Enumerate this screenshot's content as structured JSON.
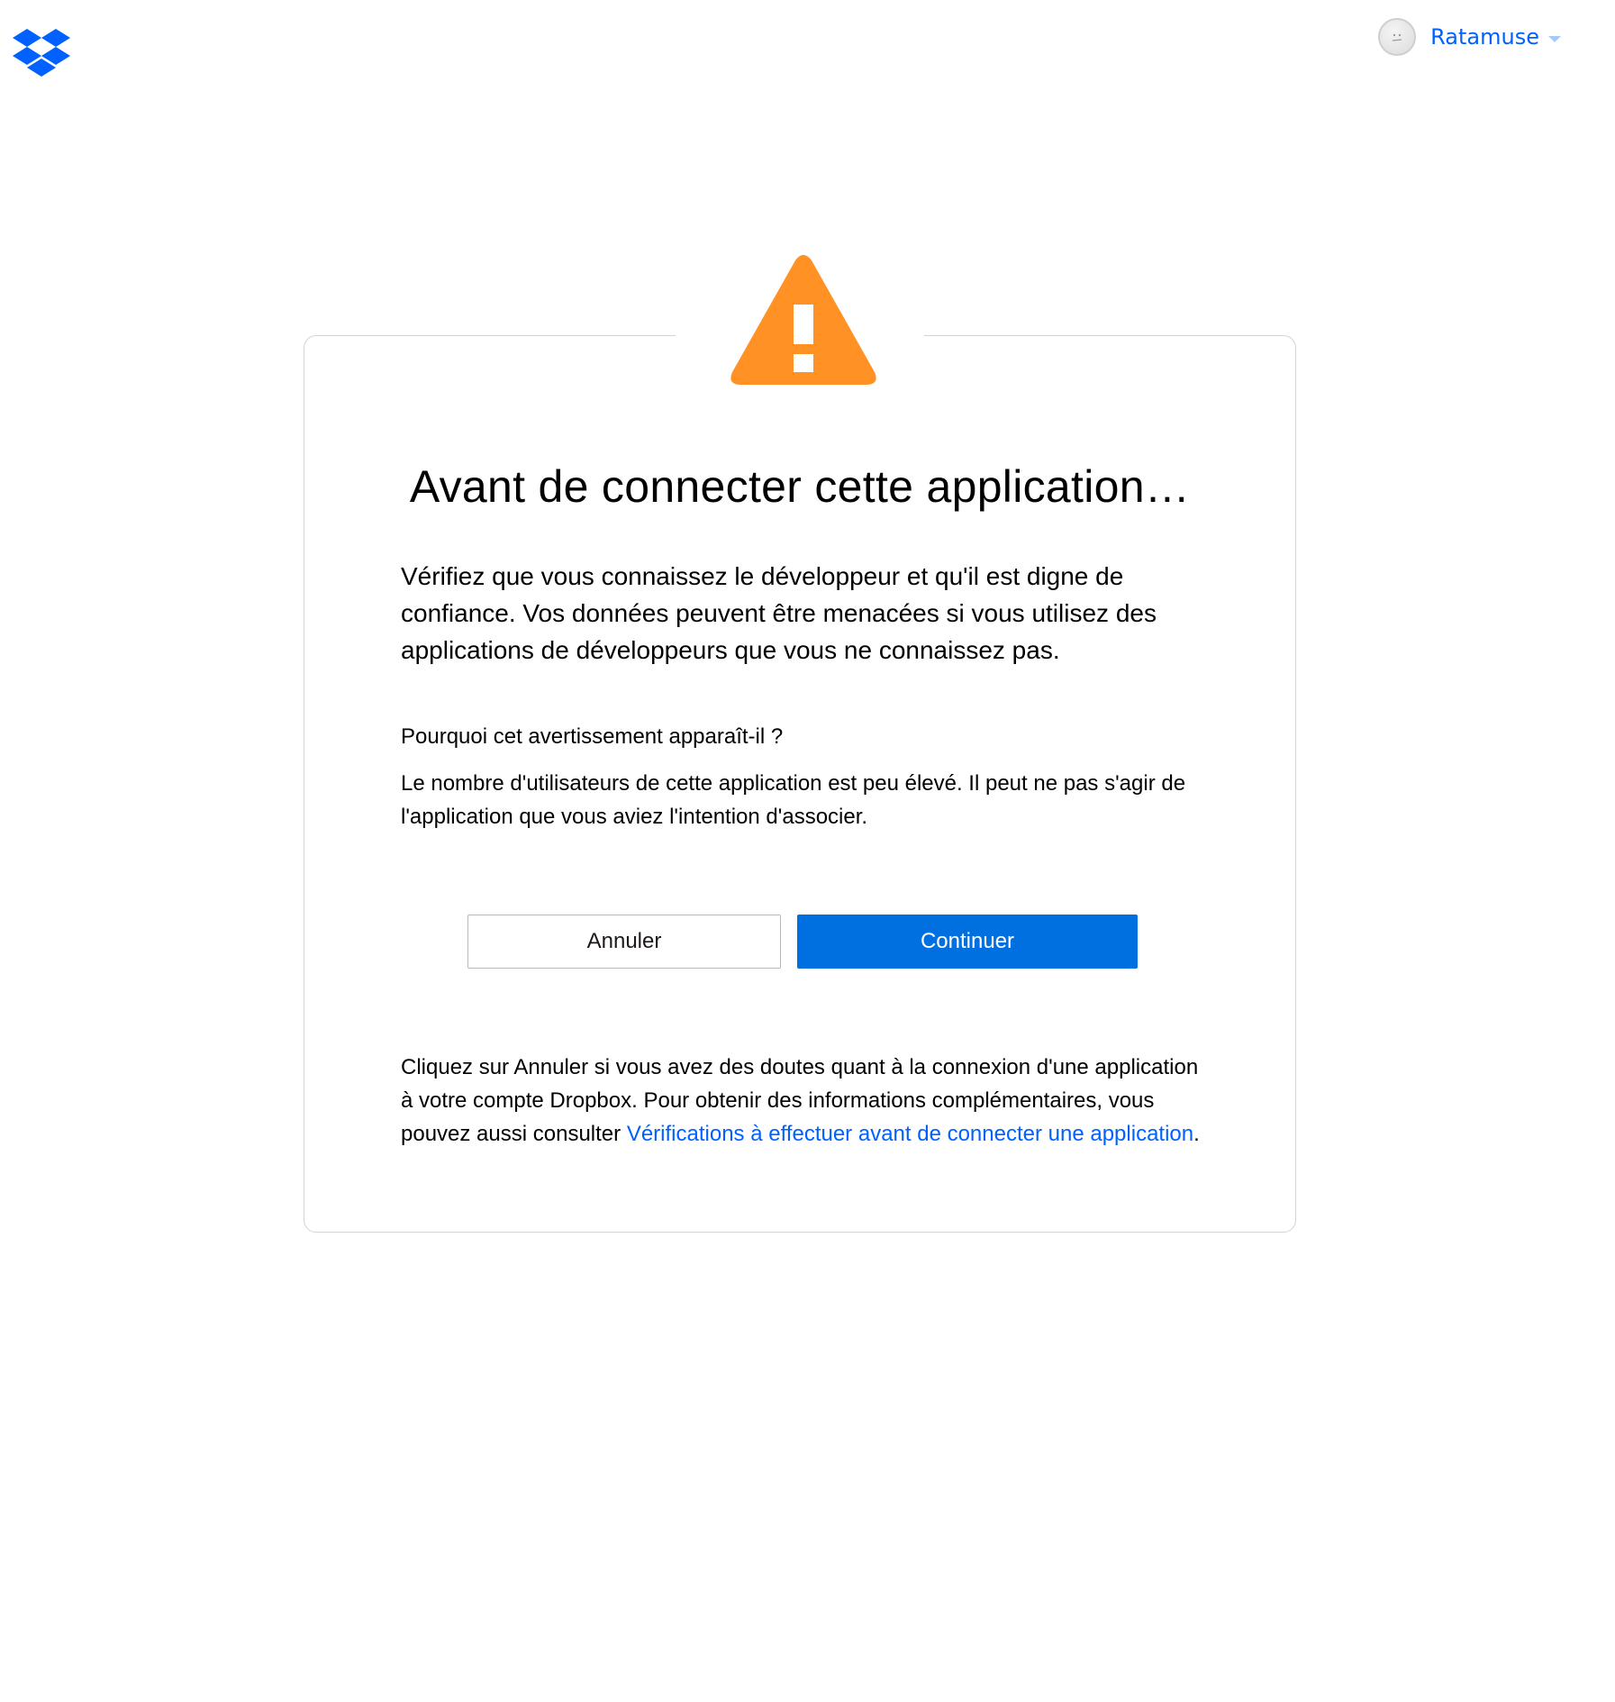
{
  "header": {
    "logo_icon": "dropbox-logo-icon",
    "account": {
      "avatar_icon": "avatar-icon",
      "name": "Ratamuse",
      "menu_icon": "chevron-down-icon"
    }
  },
  "dialog": {
    "warning_icon": "warning-triangle-icon",
    "title": "Avant de connecter cette application…",
    "lead": "Vérifiez que vous connaissez le développeur et qu'il est digne de confiance. Vos données peuvent être menacées si vous utilisez des applications de développeurs que vous ne connaissez pas.",
    "why_heading": "Pourquoi cet avertissement apparaît-il ?",
    "why_text": "Le nombre d'utilisateurs de cette application est peu élevé. Il peut ne pas s'agir de l'application que vous aviez l'intention d'associer.",
    "buttons": {
      "cancel": "Annuler",
      "continue": "Continuer"
    },
    "footer": {
      "text_before": "Cliquez sur Annuler si vous avez des doutes quant à la connexion d'une application à votre compte Dropbox. Pour obtenir des informations complémentaires, vous pouvez aussi consulter ",
      "link_text": "Vérifications à effectuer avant de connecter une application",
      "text_after": "."
    }
  },
  "colors": {
    "brand_blue": "#0061fe",
    "button_blue": "#0070e0",
    "warning_orange": "#ff9125"
  }
}
